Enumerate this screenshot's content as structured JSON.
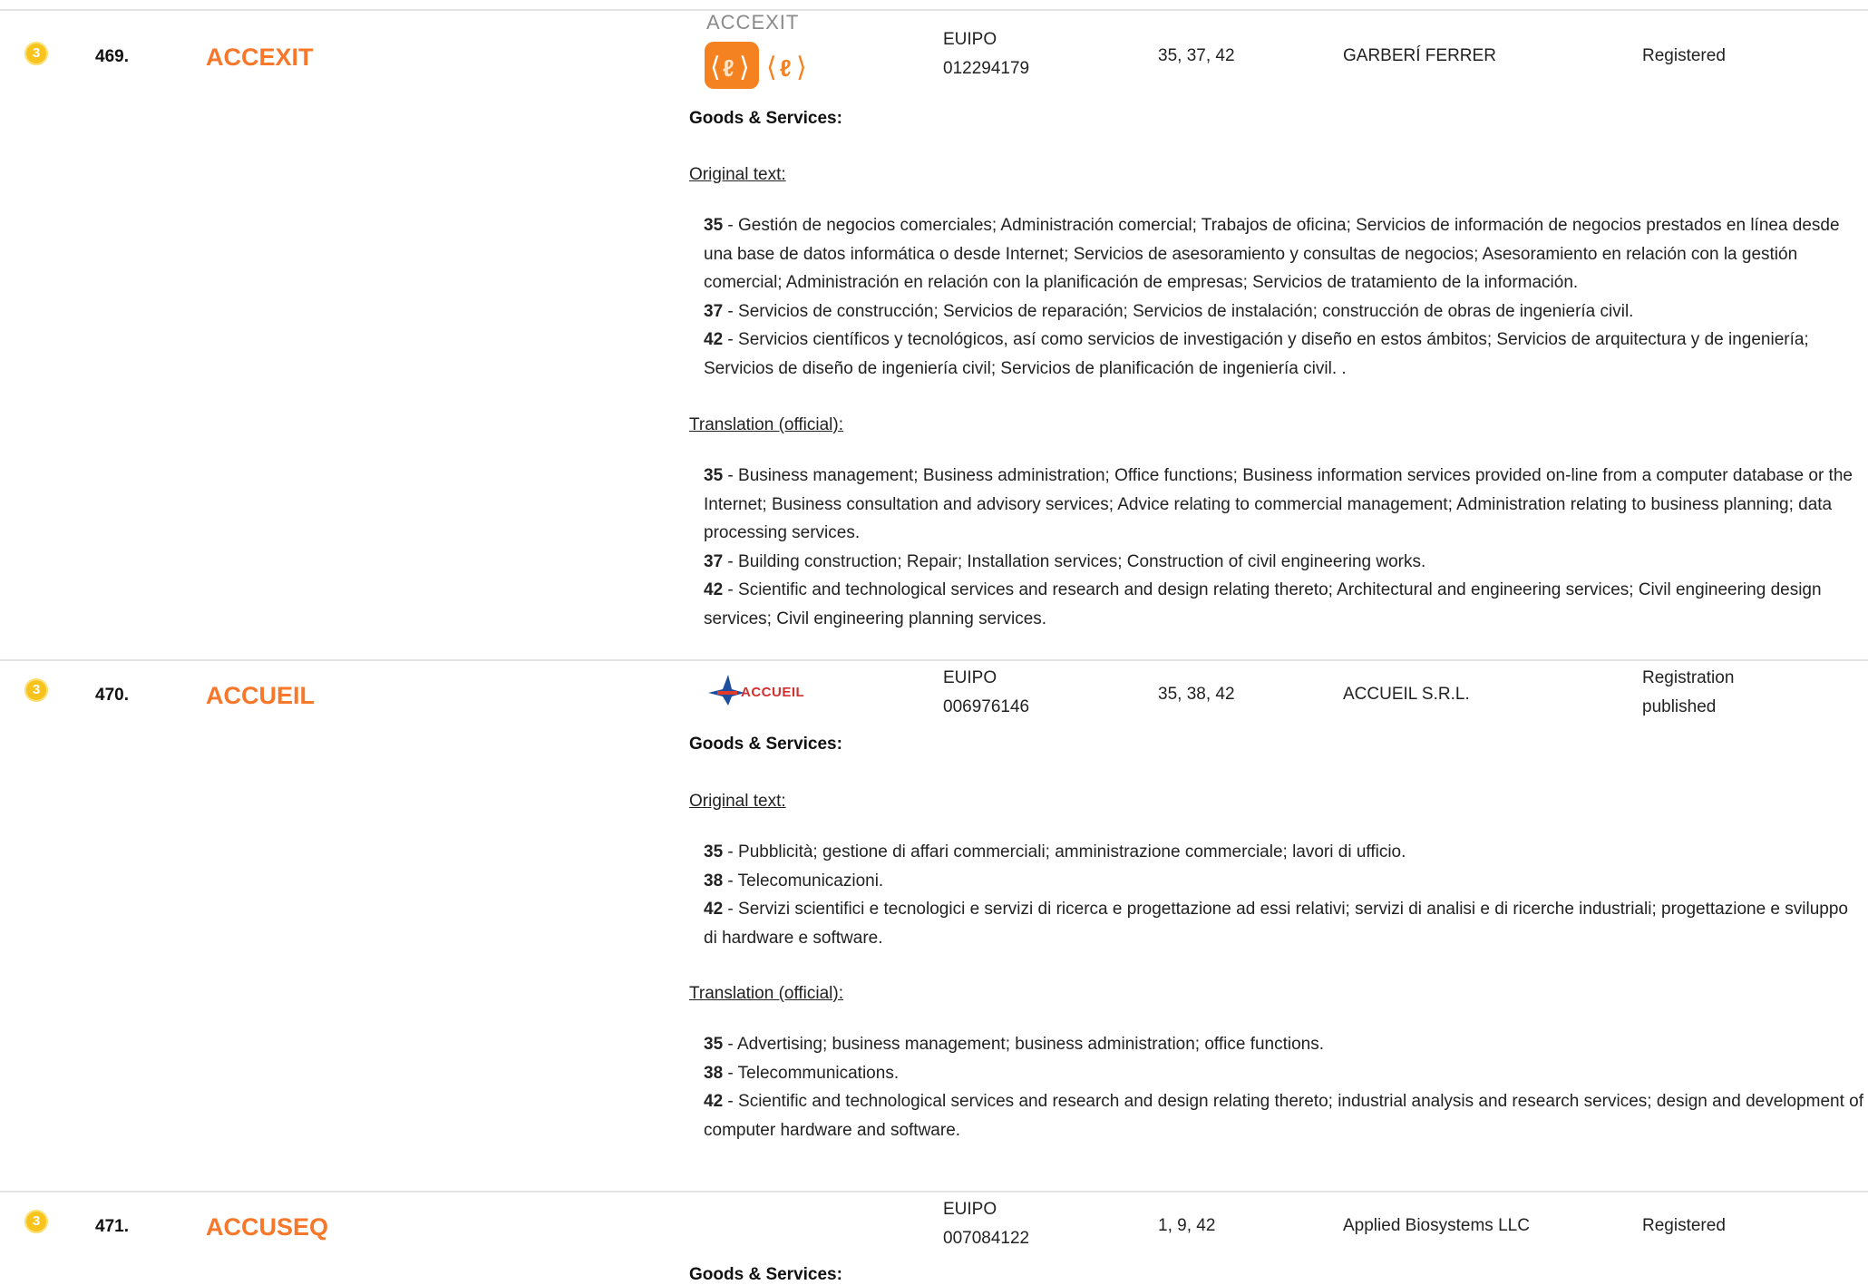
{
  "entries": [
    {
      "badge": "3",
      "number": "469.",
      "mark": "ACCEXIT",
      "logo_text": "ACCEXIT",
      "office": "EUIPO",
      "app_no": "012294179",
      "classes": "35, 37, 42",
      "owner": "GARBERÍ FERRER",
      "status": "Registered",
      "gs_title": "Goods & Services:",
      "original_label": "Original text:",
      "original": [
        {
          "cls": "35",
          "text": " - Gestión de negocios comerciales; Administración comercial; Trabajos de oficina; Servicios de información de negocios prestados en línea desde una base de datos informática o desde Internet; Servicios de asesoramiento y consultas de negocios; Asesoramiento en relación con la gestión comercial; Administración en relación con la planificación de empresas; Servicios de tratamiento de la información."
        },
        {
          "cls": "37",
          "text": " - Servicios de construcción; Servicios de reparación; Servicios de instalación; construcción de obras de ingeniería civil."
        },
        {
          "cls": "42",
          "text": " - Servicios científicos y tecnológicos, así como servicios de investigación y diseño en estos ámbitos; Servicios de arquitectura y de ingeniería; Servicios de diseño de ingeniería civil; Servicios de planificación de ingeniería civil. ."
        }
      ],
      "translation_label": "Translation (official):",
      "translation": [
        {
          "cls": "35",
          "text": " - Business management; Business administration; Office functions; Business information services provided on-line from a computer database or the Internet; Business consultation and advisory services; Advice relating to commercial management; Administration relating to business planning; data processing services."
        },
        {
          "cls": "37",
          "text": " - Building construction; Repair; Installation services; Construction of civil engineering works."
        },
        {
          "cls": "42",
          "text": " - Scientific and technological services and research and design relating thereto; Architectural and engineering services; Civil engineering design services; Civil engineering planning services."
        }
      ]
    },
    {
      "badge": "3",
      "number": "470.",
      "mark": "ACCUEIL",
      "logo_text": "ACCUEIL",
      "office": "EUIPO",
      "app_no": "006976146",
      "classes": "35, 38, 42",
      "owner": "ACCUEIL S.R.L.",
      "status_line1": "Registration",
      "status_line2": "published",
      "gs_title": "Goods & Services:",
      "original_label": "Original text:",
      "original": [
        {
          "cls": "35",
          "text": " - Pubblicità; gestione di affari commerciali; amministrazione commerciale; lavori di ufficio."
        },
        {
          "cls": "38",
          "text": " - Telecomunicazioni."
        },
        {
          "cls": "42",
          "text": " - Servizi scientifici e tecnologici e servizi di ricerca e progettazione ad essi relativi; servizi di analisi e di ricerche industriali; progettazione e sviluppo di hardware e software."
        }
      ],
      "translation_label": "Translation (official):",
      "translation": [
        {
          "cls": "35",
          "text": " - Advertising; business management; business administration; office functions."
        },
        {
          "cls": "38",
          "text": " - Telecommunications."
        },
        {
          "cls": "42",
          "text": " - Scientific and technological services and research and design relating thereto; industrial analysis and research services; design and development of computer hardware and software."
        }
      ]
    },
    {
      "badge": "3",
      "number": "471.",
      "mark": "ACCUSEQ",
      "office": "EUIPO",
      "app_no": "007084122",
      "classes": "1, 9, 42",
      "owner": "Applied Biosystems LLC",
      "status": "Registered",
      "gs_title": "Goods & Services:"
    }
  ],
  "colors": {
    "accent": "#f7782a",
    "badge": "#f7c31c",
    "separator": "#e3e3e3"
  }
}
